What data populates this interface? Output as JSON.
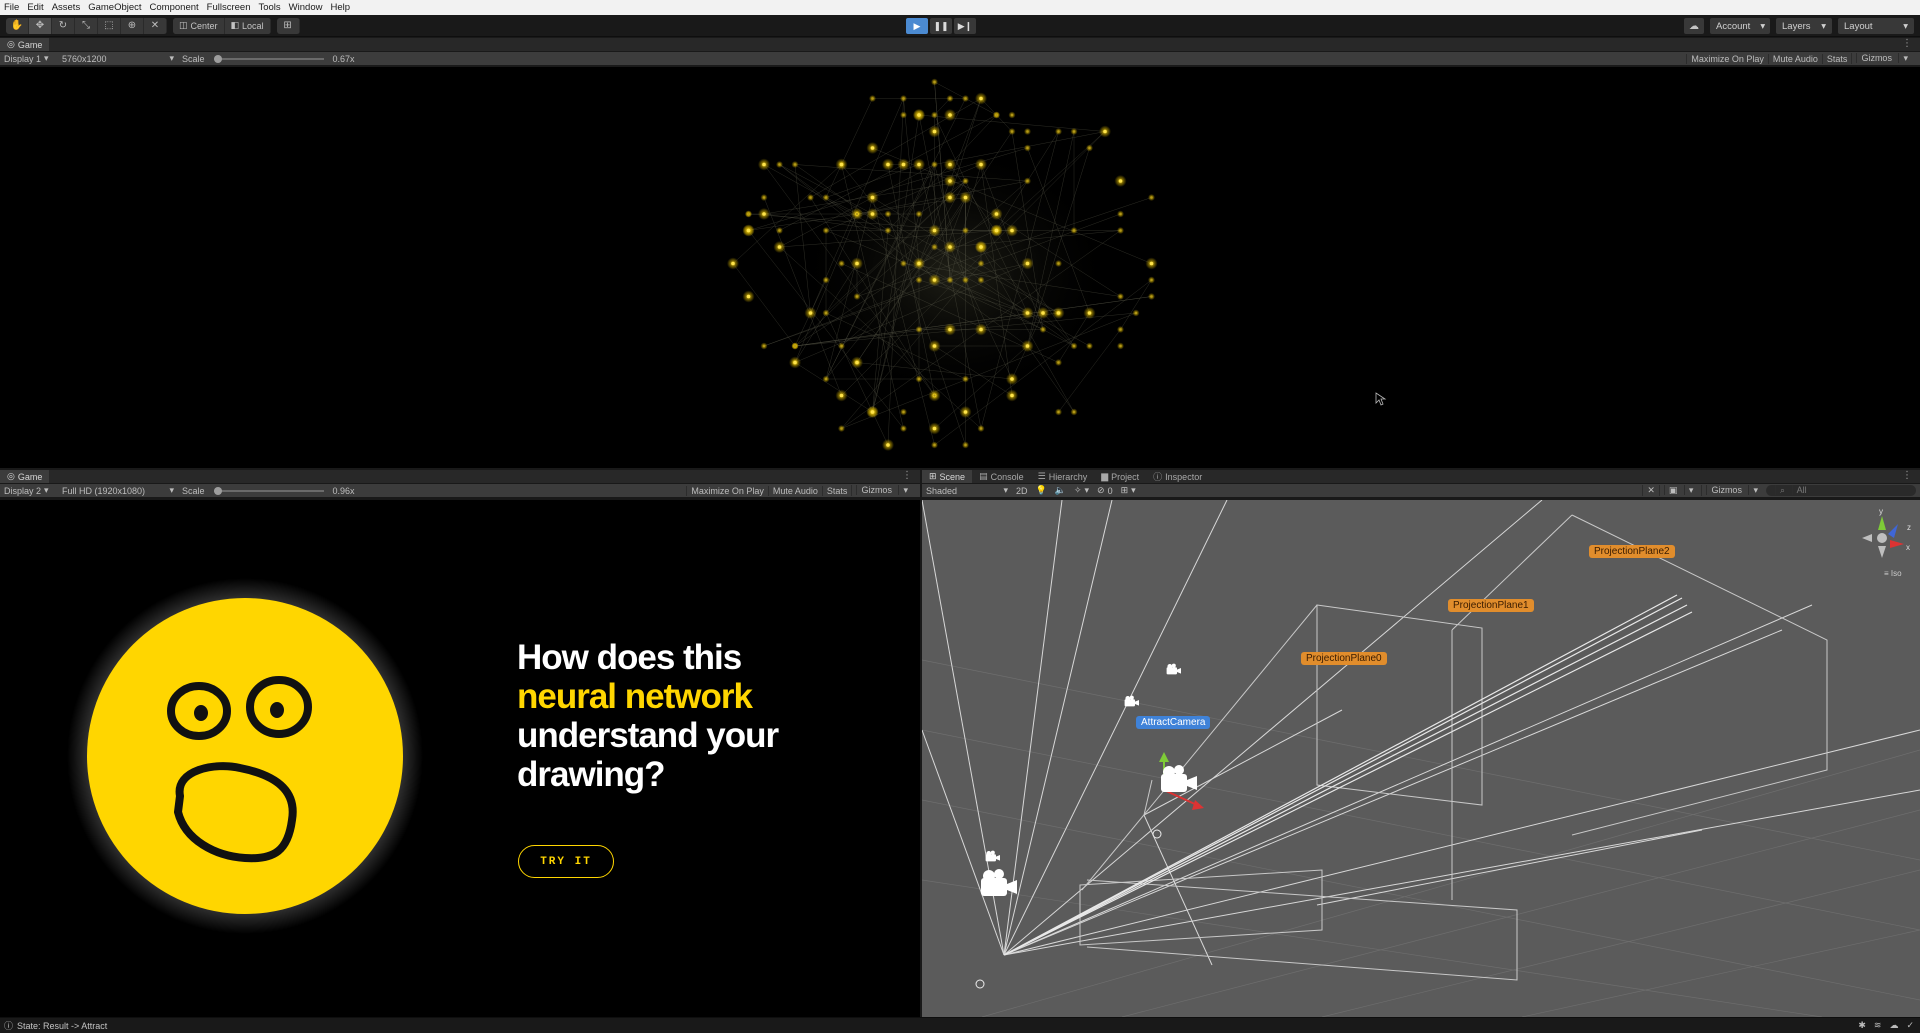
{
  "menu": [
    "File",
    "Edit",
    "Assets",
    "GameObject",
    "Component",
    "Fullscreen",
    "Tools",
    "Window",
    "Help"
  ],
  "toolbar": {
    "tools": [
      "hand-tool-icon",
      "move-tool-icon",
      "rotate-tool-icon",
      "scale-tool-icon",
      "rect-tool-icon",
      "transform-tool-icon",
      "custom-tool-icon"
    ],
    "pivot_center": "Center",
    "pivot_local": "Local",
    "account": "Account",
    "layers": "Layers",
    "layout": "Layout"
  },
  "game1": {
    "tab": "Game",
    "display": "Display 1",
    "resolution": "5760x1200",
    "scale_label": "Scale",
    "scale_value": "0.67x",
    "maximize": "Maximize On Play",
    "mute": "Mute Audio",
    "stats": "Stats",
    "gizmos": "Gizmos"
  },
  "game2": {
    "tab": "Game",
    "display": "Display 2",
    "resolution": "Full HD (1920x1080)",
    "scale_label": "Scale",
    "scale_value": "0.96x",
    "maximize": "Maximize On Play",
    "mute": "Mute Audio",
    "stats": "Stats",
    "gizmos": "Gizmos",
    "headline_1": "How does this",
    "headline_2": "neural network",
    "headline_3": "understand your",
    "headline_4": "drawing?",
    "cta": "TRY IT"
  },
  "scene": {
    "tabs": [
      "Scene",
      "Console",
      "Hierarchy",
      "Project",
      "Inspector"
    ],
    "shading": "Shaded",
    "mode_2d": "2D",
    "hidden_count": "0",
    "gizmos": "Gizmos",
    "search_placeholder": "All",
    "iso_label": "Iso",
    "axis_y": "y",
    "axis_z": "z",
    "axis_x": "x",
    "labels": {
      "plane2": "ProjectionPlane2",
      "plane1": "ProjectionPlane1",
      "plane0": "ProjectionPlane0",
      "camera": "AttractCamera"
    }
  },
  "status": {
    "text": "State: Result -> Attract"
  },
  "colors": {
    "accent_yellow": "#ffd600",
    "play_blue": "#4b8ad1",
    "label_orange": "#e18d2c",
    "label_blue": "#3f82d8"
  }
}
